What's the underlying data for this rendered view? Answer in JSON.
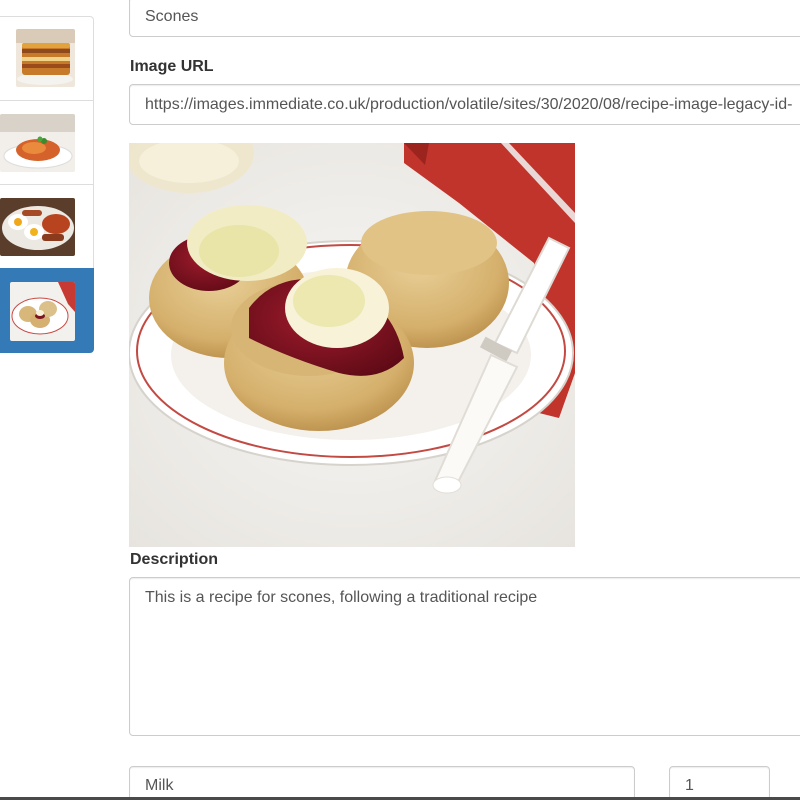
{
  "recipes": [
    {
      "icon": "lasagna-thumbnail",
      "active": false
    },
    {
      "icon": "spaghetti-thumbnail",
      "active": false
    },
    {
      "icon": "breakfast-thumbnail",
      "active": false
    },
    {
      "icon": "scones-thumbnail",
      "active": true
    }
  ],
  "form": {
    "name_value": "Scones",
    "image_url_label": "Image URL",
    "image_url_value": "https://images.immediate.co.uk/production/volatile/sites/30/2020/08/recipe-image-legacy-id-",
    "description_label": "Description",
    "description_value": "This is a recipe for scones, following a traditional recipe",
    "ingredient": {
      "name": "Milk",
      "amount": "1"
    }
  },
  "colors": {
    "active_item": "#337ab7",
    "input_border": "#cccccc",
    "text": "#333333"
  }
}
